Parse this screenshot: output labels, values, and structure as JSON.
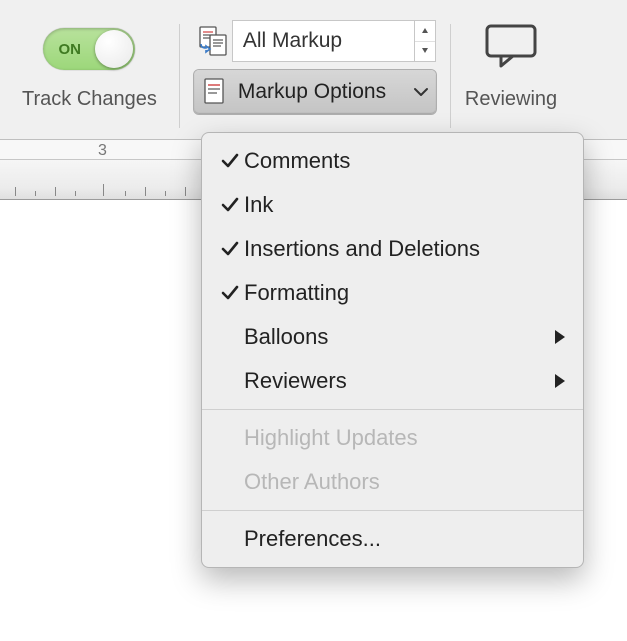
{
  "toolbar": {
    "track_changes": {
      "toggle_state": "ON",
      "caption": "Track Changes"
    },
    "markup": {
      "display_value": "All Markup",
      "options_button": "Markup Options"
    },
    "reviewing": {
      "caption": "Reviewing"
    }
  },
  "ruler": {
    "numbers": [
      "3"
    ]
  },
  "menu": {
    "items": [
      {
        "label": "Comments",
        "checked": true,
        "submenu": false,
        "enabled": true
      },
      {
        "label": "Ink",
        "checked": true,
        "submenu": false,
        "enabled": true
      },
      {
        "label": "Insertions and Deletions",
        "checked": true,
        "submenu": false,
        "enabled": true
      },
      {
        "label": "Formatting",
        "checked": true,
        "submenu": false,
        "enabled": true
      },
      {
        "label": "Balloons",
        "checked": false,
        "submenu": true,
        "enabled": true
      },
      {
        "label": "Reviewers",
        "checked": false,
        "submenu": true,
        "enabled": true
      }
    ],
    "disabled_items": [
      {
        "label": "Highlight Updates"
      },
      {
        "label": "Other Authors"
      }
    ],
    "preferences": "Preferences..."
  }
}
